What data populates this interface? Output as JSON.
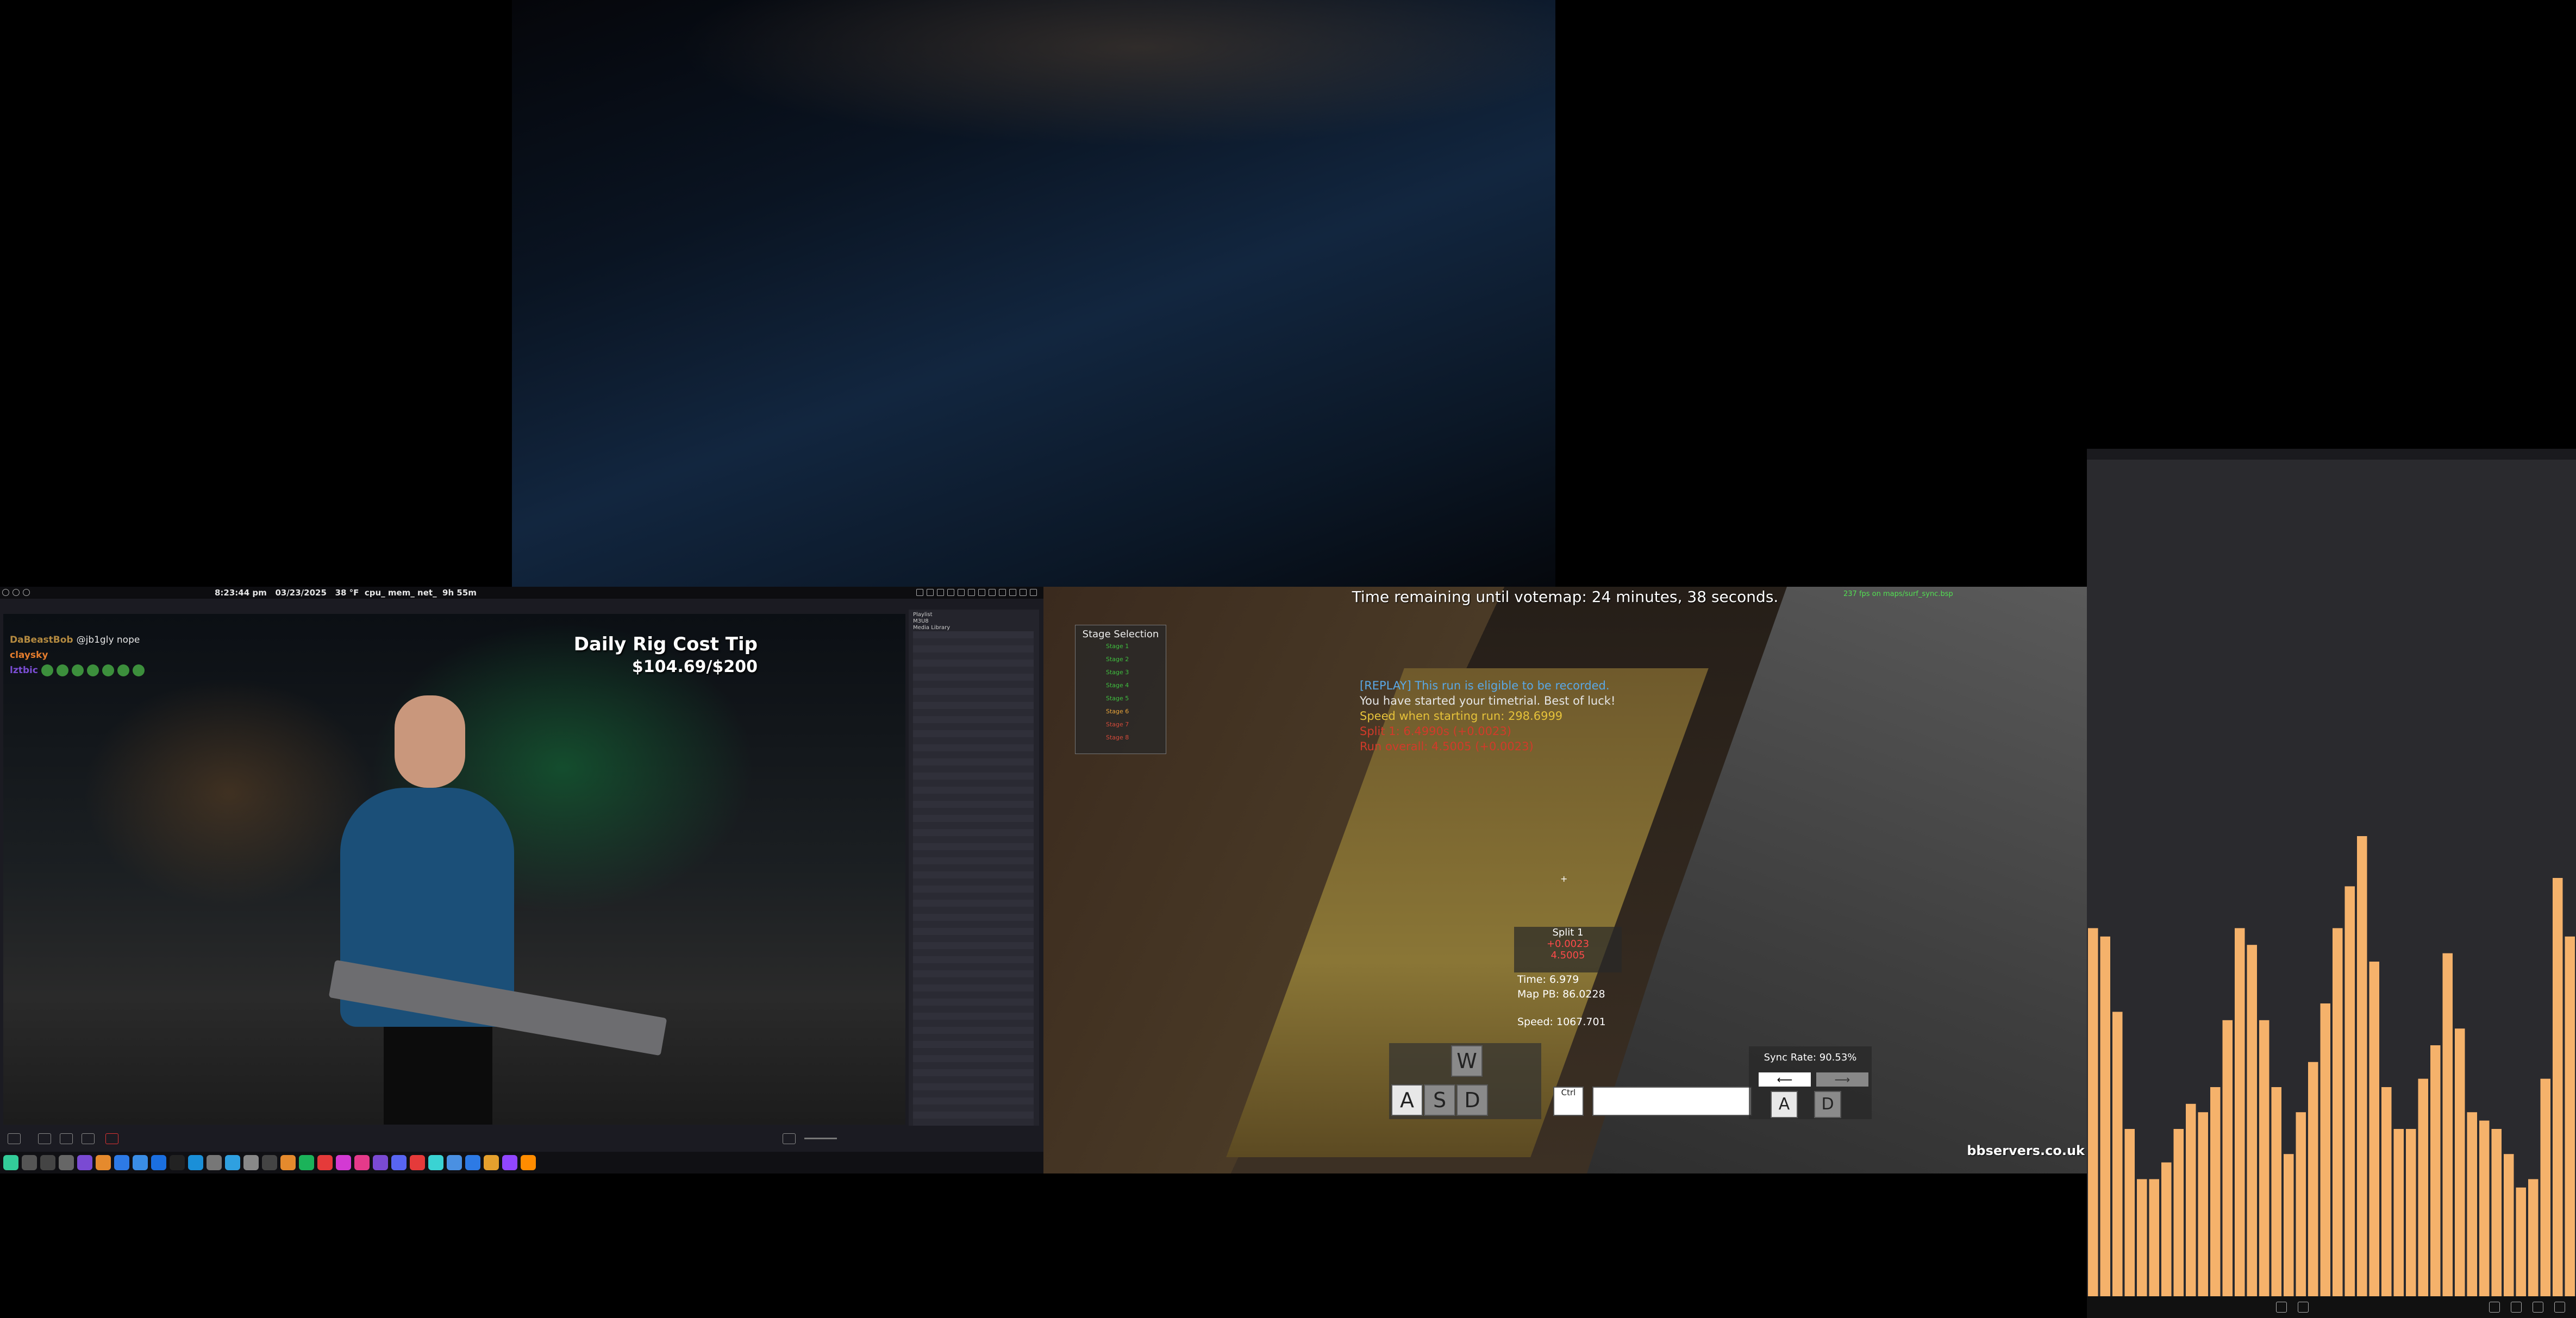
{
  "topbar": {
    "time": "8:23:44 pm",
    "date": "03/23/2025",
    "weather": "38 °F",
    "monitors": "cpu_ mem_ net_",
    "uptime": "9h 55m"
  },
  "stream": {
    "overlay_title": "Daily Rig Cost Tip",
    "overlay_amount": "$104.69/$200",
    "chat": [
      {
        "user": "DaBeastBob",
        "message": "@jb1gly nope"
      },
      {
        "user": "claysky",
        "message": ""
      },
      {
        "user": "lztbic",
        "message": ""
      }
    ]
  },
  "playlist": {
    "header1": "Playlist",
    "header2": "M3U8",
    "header3": "Media Library"
  },
  "game": {
    "vote_text": "Time remaining until votemap: 24 minutes, 38 seconds.",
    "fps_text": "237 fps on maps/surf_sync.bsp",
    "stage_title": "Stage Selection",
    "stages": [
      "Stage 1",
      "Stage 2",
      "Stage 3",
      "Stage 4",
      "Stage 5",
      "Stage 6",
      "Stage 7",
      "Stage 8"
    ],
    "chatlog": [
      {
        "text": "[REPLAY] This run is eligible to be recorded.",
        "color": "#5aa8e6"
      },
      {
        "text": "You have started your timetrial. Best of luck!",
        "color": "#e6e6e6"
      },
      {
        "text": "Speed when starting run: 298.6999",
        "color": "#e6c23a"
      },
      {
        "text": "Split 1: 6.4990s (+0.0023)",
        "color": "#d23a2a"
      },
      {
        "text": "Run overall: 4.5005 (+0.0023)",
        "color": "#d23a2a"
      }
    ],
    "split_title": "Split 1",
    "split_delta1": "+0.0023",
    "split_delta2": "4.5005",
    "time": "Time: 6.979",
    "map_pb": "Map PB: 86.0228",
    "speed": "Speed: 1067.701",
    "keys": {
      "w": "W",
      "a": "A",
      "s": "S",
      "d": "D",
      "ctrl": "Ctrl"
    },
    "sync_rate": "Sync Rate: 90.53%",
    "sync_keys": {
      "a": "A",
      "d": "D"
    },
    "site": "bbservers.co.uk"
  },
  "visualizer": {
    "color": "#f5b26b",
    "bars": [
      0.44,
      0.43,
      0.34,
      0.2,
      0.14,
      0.14,
      0.16,
      0.2,
      0.23,
      0.22,
      0.25,
      0.33,
      0.44,
      0.42,
      0.33,
      0.25,
      0.17,
      0.22,
      0.28,
      0.35,
      0.44,
      0.49,
      0.55,
      0.4,
      0.25,
      0.2,
      0.2,
      0.26,
      0.3,
      0.41,
      0.32,
      0.22,
      0.21,
      0.2,
      0.17,
      0.13,
      0.14,
      0.26,
      0.5,
      0.43
    ]
  }
}
